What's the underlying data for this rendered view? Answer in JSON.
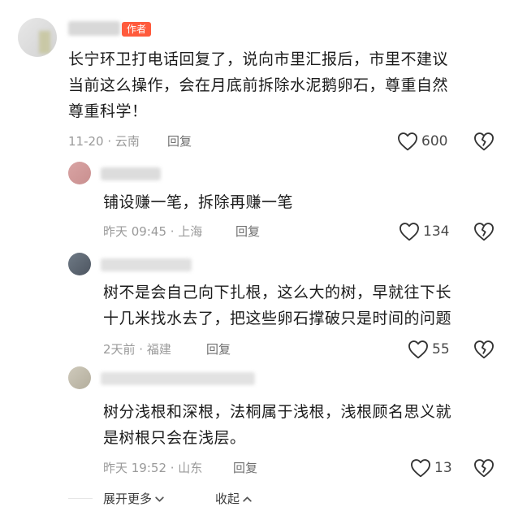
{
  "comments": [
    {
      "author_badge": "作者",
      "text": "长宁环卫打电话回复了，说向市里汇报后，市里不建议当前这么操作，会在月底前拆除水泥鹅卵石，尊重自然尊重科学！",
      "line1": "长宁环卫打电话回复了，说向市里汇报后，市里不建议",
      "line2": "当前这么操作，会在月底前拆除水泥鹅卵石，尊重自然",
      "line3": "尊重科学！",
      "time_location": "11-20 · 云南",
      "reply_label": "回复",
      "likes": "600"
    },
    {
      "line1": "铺设赚一笔，拆除再赚一笔",
      "time_location": "昨天 09:45 · 上海",
      "reply_label": "回复",
      "likes": "134"
    },
    {
      "line1": "树不是会自己向下扎根，这么大的树，早就往下长",
      "line2": "十几米找水去了，把这些卵石撑破只是时间的问题",
      "time_location": "2天前 · 福建",
      "reply_label": "回复",
      "likes": "55"
    },
    {
      "line1": "树分浅根和深根，法桐属于浅根，浅根顾名思义就",
      "line2": "是树根只会在浅层。",
      "time_location": "昨天 19:52 · 山东",
      "reply_label": "回复",
      "likes": "13"
    }
  ],
  "footer": {
    "expand_label": "展开更多",
    "collapse_label": "收起"
  },
  "colors": {
    "author_badge": "#ff5a3c",
    "meta_text": "#9a9a9a"
  }
}
